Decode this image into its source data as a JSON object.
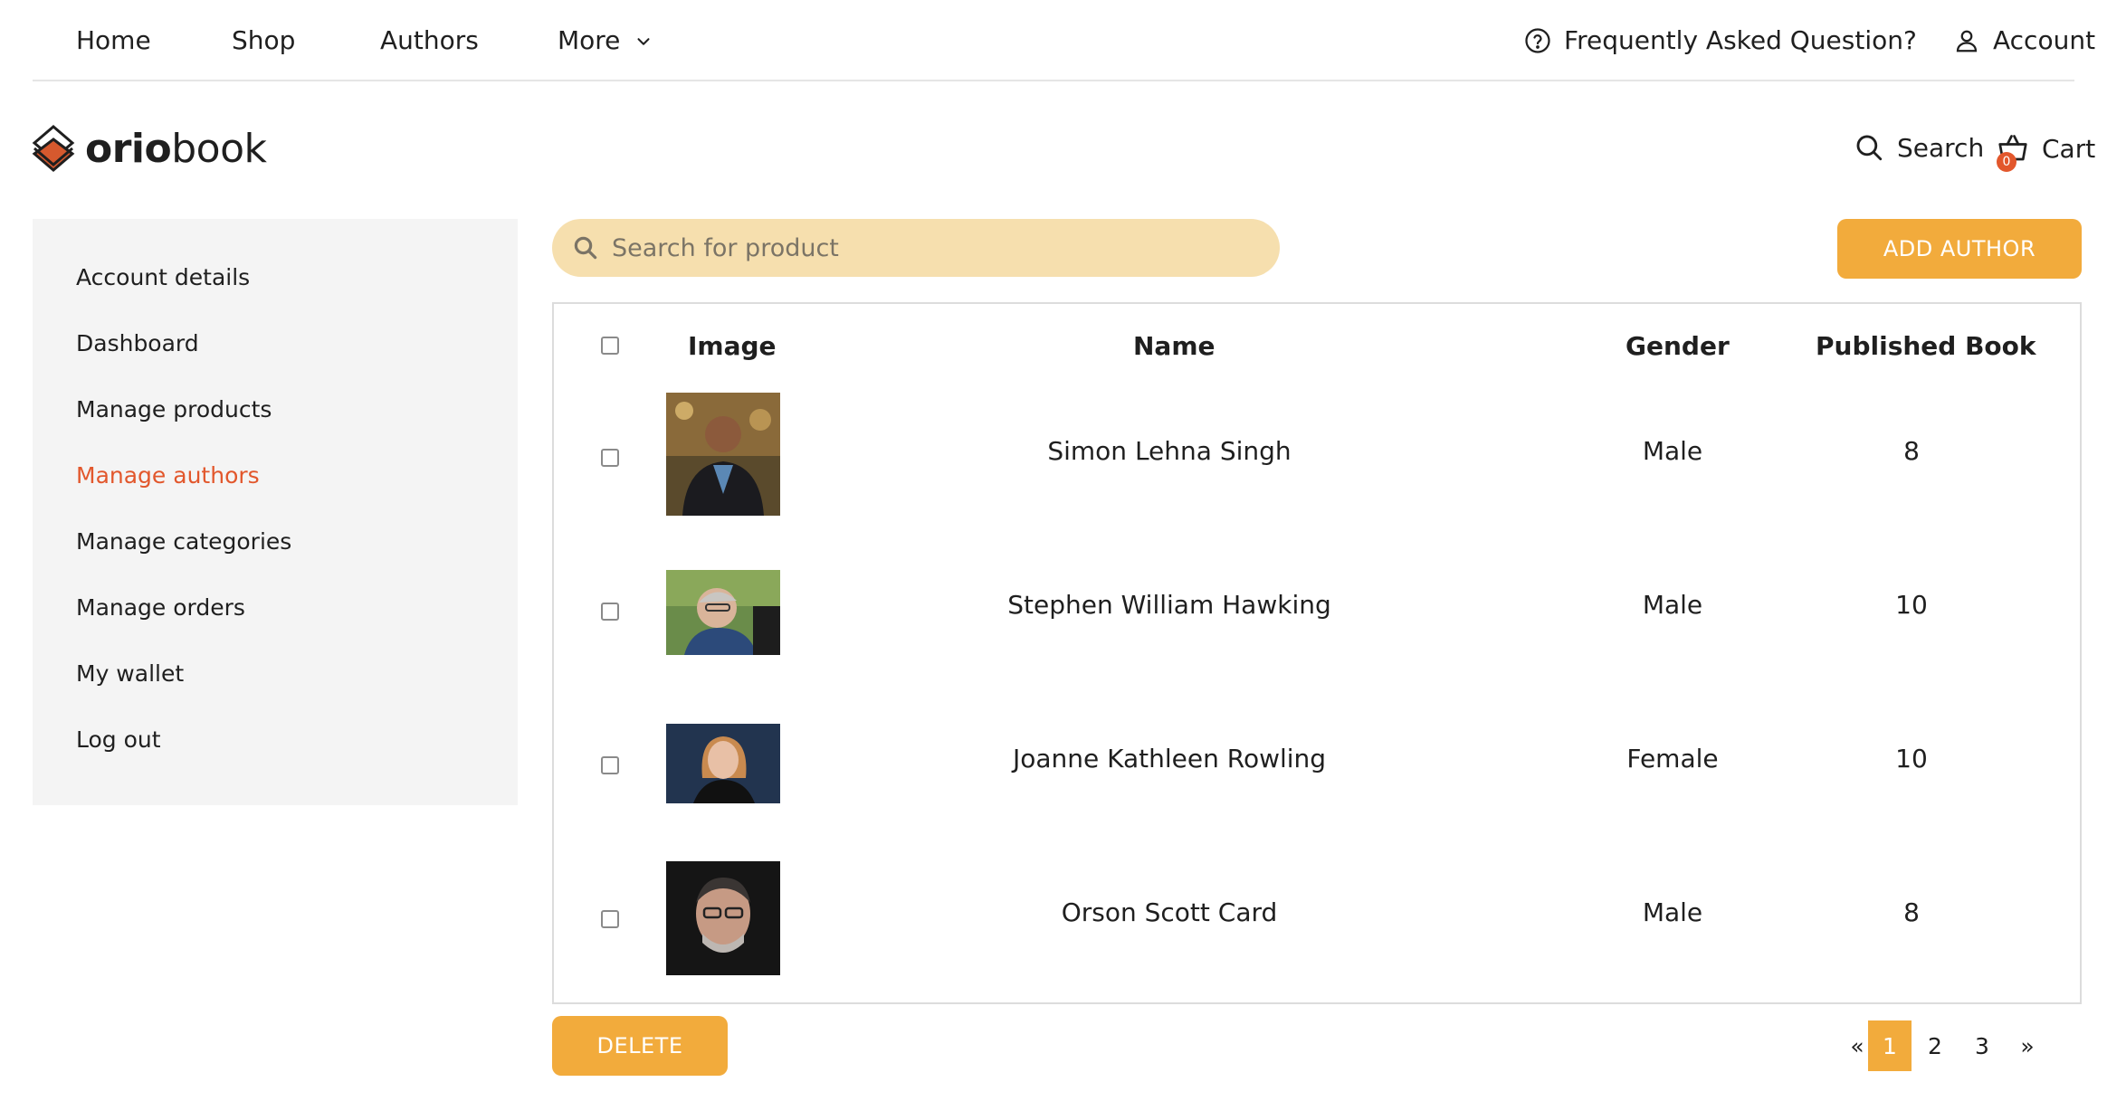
{
  "topnav": {
    "items": [
      {
        "label": "Home"
      },
      {
        "label": "Shop"
      },
      {
        "label": "Authors"
      },
      {
        "label": "More"
      }
    ],
    "faq_label": "Frequently Asked Question?",
    "account_label": "Account"
  },
  "header": {
    "logo_bold": "orio",
    "logo_light": "book",
    "search_label": "Search",
    "cart_label": "Cart",
    "cart_count": "0"
  },
  "sidebar": {
    "items": [
      {
        "label": "Account details",
        "active": false
      },
      {
        "label": "Dashboard",
        "active": false
      },
      {
        "label": "Manage products",
        "active": false
      },
      {
        "label": "Manage authors",
        "active": true
      },
      {
        "label": "Manage categories",
        "active": false
      },
      {
        "label": "Manage orders",
        "active": false
      },
      {
        "label": "My wallet",
        "active": false
      },
      {
        "label": "Log out",
        "active": false
      }
    ]
  },
  "search": {
    "placeholder": "Search for product"
  },
  "add_button": "ADD AUTHOR",
  "delete_button": "DELETE",
  "table": {
    "headers": {
      "image": "Image",
      "name": "Name",
      "gender": "Gender",
      "published": "Published Book"
    },
    "rows": [
      {
        "name": "Simon Lehna Singh",
        "gender": "Male",
        "published": "8"
      },
      {
        "name": "Stephen William Hawking",
        "gender": "Male",
        "published": "10"
      },
      {
        "name": "Joanne Kathleen Rowling",
        "gender": "Female",
        "published": "10"
      },
      {
        "name": "Orson Scott Card",
        "gender": "Male",
        "published": "8"
      }
    ]
  },
  "pagination": {
    "prev": "«",
    "pages": [
      "1",
      "2",
      "3"
    ],
    "next": "»",
    "current": "1"
  },
  "colors": {
    "accent": "#f2ab3c",
    "active_link": "#e2572c",
    "search_bg": "#f6dfae",
    "sidebar_bg": "#f4f4f4"
  }
}
